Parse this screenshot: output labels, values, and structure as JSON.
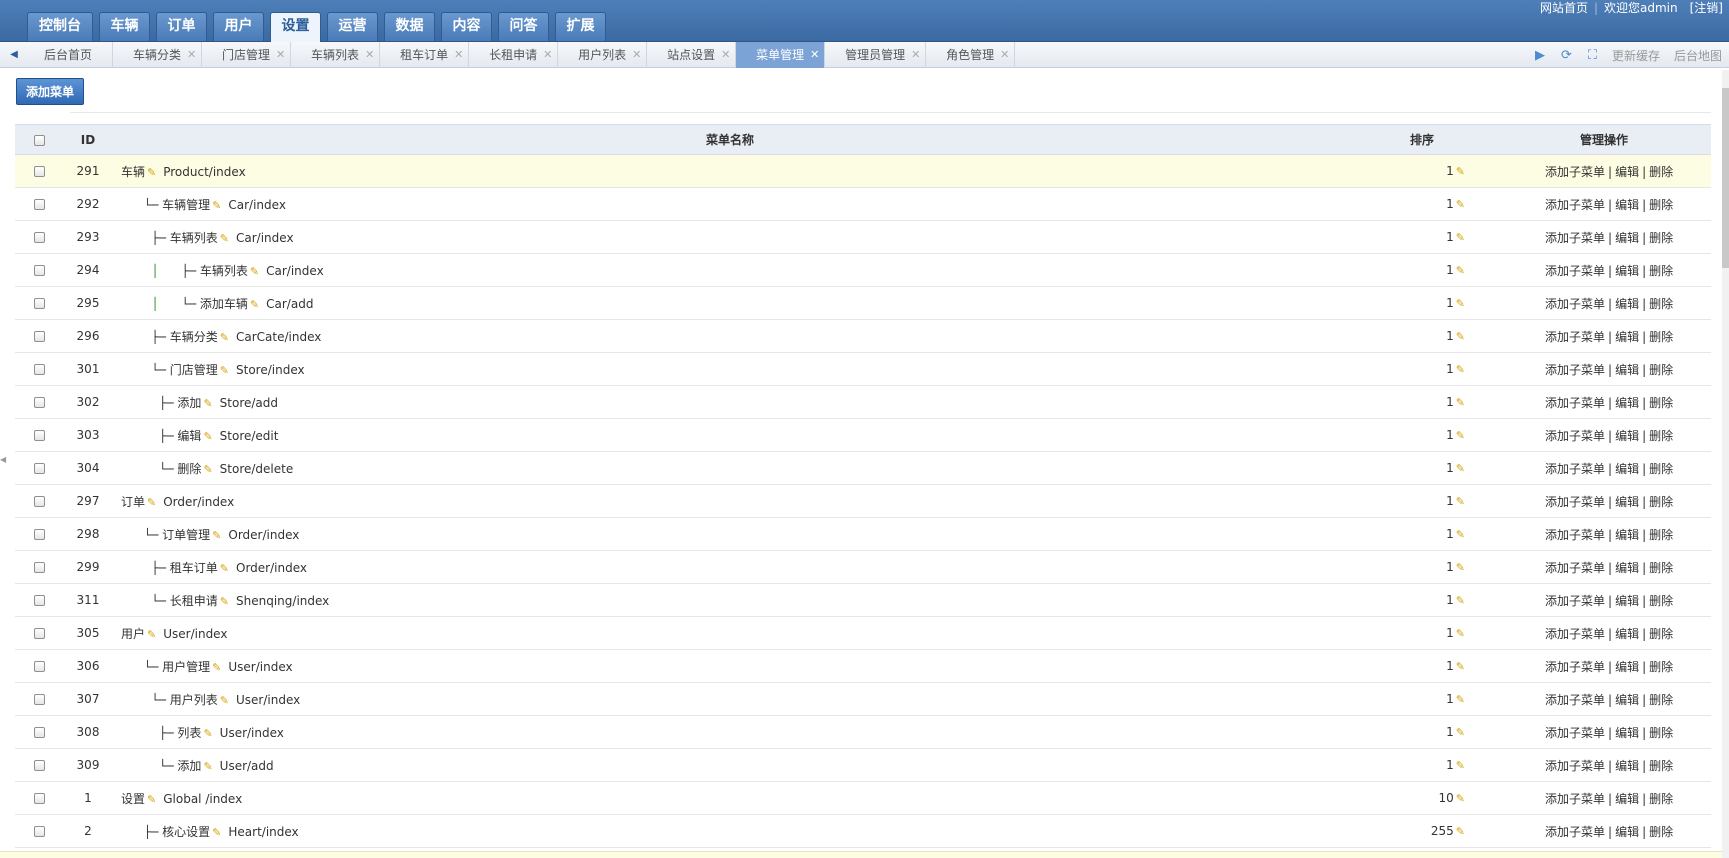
{
  "nav": {
    "tabs": [
      "控制台",
      "车辆",
      "订单",
      "用户",
      "设置",
      "运营",
      "数据",
      "内容",
      "问答",
      "扩展"
    ],
    "active_index": 4
  },
  "top_links": {
    "site_home": "网站首页",
    "welcome": "欢迎您admin",
    "logout": "[注销]"
  },
  "tabstrip": {
    "tabs": [
      {
        "label": "后台首页",
        "closable": false
      },
      {
        "label": "车辆分类",
        "closable": true
      },
      {
        "label": "门店管理",
        "closable": true
      },
      {
        "label": "车辆列表",
        "closable": true
      },
      {
        "label": "租车订单",
        "closable": true
      },
      {
        "label": "长租申请",
        "closable": true
      },
      {
        "label": "用户列表",
        "closable": true
      },
      {
        "label": "站点设置",
        "closable": true
      },
      {
        "label": "菜单管理",
        "closable": true,
        "active": true
      },
      {
        "label": "管理员管理",
        "closable": true
      },
      {
        "label": "角色管理",
        "closable": true
      }
    ],
    "close_glyph": "✕",
    "refresh_cache": "更新缓存",
    "site_map": "后台地图"
  },
  "toolbar": {
    "add_menu_label": "添加菜单"
  },
  "table": {
    "headers": {
      "id": "ID",
      "name": "菜单名称",
      "sort": "排序",
      "ops": "管理操作"
    },
    "op_labels": {
      "add_child": "添加子菜单",
      "edit": "编辑",
      "delete": "删除",
      "sep": "|"
    },
    "rows": [
      {
        "id": "291",
        "prefix": "",
        "green": "",
        "tail": "",
        "name": "车辆",
        "path": "Product/index",
        "sort": "1",
        "highlight": true
      },
      {
        "id": "292",
        "prefix": "      └─ ",
        "green": "",
        "tail": "",
        "name": "车辆管理",
        "path": "Car/index",
        "sort": "1"
      },
      {
        "id": "293",
        "prefix": "        ├─ ",
        "green": "",
        "tail": "",
        "name": "车辆列表",
        "path": "Car/index",
        "sort": "1"
      },
      {
        "id": "294",
        "prefix": "        ",
        "green": "│",
        "tail": "      ├─ ",
        "name": "车辆列表",
        "path": "Car/index",
        "sort": "1"
      },
      {
        "id": "295",
        "prefix": "        ",
        "green": "│",
        "tail": "      └─ ",
        "name": "添加车辆",
        "path": "Car/add",
        "sort": "1"
      },
      {
        "id": "296",
        "prefix": "        ├─ ",
        "green": "",
        "tail": "",
        "name": "车辆分类",
        "path": "CarCate/index",
        "sort": "1"
      },
      {
        "id": "301",
        "prefix": "        └─ ",
        "green": "",
        "tail": "",
        "name": "门店管理",
        "path": "Store/index",
        "sort": "1"
      },
      {
        "id": "302",
        "prefix": "          ├─ ",
        "green": "",
        "tail": "",
        "name": "添加",
        "path": "Store/add",
        "sort": "1"
      },
      {
        "id": "303",
        "prefix": "          ├─ ",
        "green": "",
        "tail": "",
        "name": "编辑",
        "path": "Store/edit",
        "sort": "1"
      },
      {
        "id": "304",
        "prefix": "          └─ ",
        "green": "",
        "tail": "",
        "name": "删除",
        "path": "Store/delete",
        "sort": "1"
      },
      {
        "id": "297",
        "prefix": "",
        "green": "",
        "tail": "",
        "name": "订单",
        "path": "Order/index",
        "sort": "1"
      },
      {
        "id": "298",
        "prefix": "      └─ ",
        "green": "",
        "tail": "",
        "name": "订单管理",
        "path": "Order/index",
        "sort": "1"
      },
      {
        "id": "299",
        "prefix": "        ├─ ",
        "green": "",
        "tail": "",
        "name": "租车订单",
        "path": "Order/index",
        "sort": "1"
      },
      {
        "id": "311",
        "prefix": "        └─ ",
        "green": "",
        "tail": "",
        "name": "长租申请",
        "path": "Shenqing/index",
        "sort": "1"
      },
      {
        "id": "305",
        "prefix": "",
        "green": "",
        "tail": "",
        "name": "用户",
        "path": "User/index",
        "sort": "1"
      },
      {
        "id": "306",
        "prefix": "      └─ ",
        "green": "",
        "tail": "",
        "name": "用户管理",
        "path": "User/index",
        "sort": "1"
      },
      {
        "id": "307",
        "prefix": "        └─ ",
        "green": "",
        "tail": "",
        "name": "用户列表",
        "path": "User/index",
        "sort": "1"
      },
      {
        "id": "308",
        "prefix": "          ├─ ",
        "green": "",
        "tail": "",
        "name": "列表",
        "path": "User/index",
        "sort": "1"
      },
      {
        "id": "309",
        "prefix": "          └─ ",
        "green": "",
        "tail": "",
        "name": "添加",
        "path": "User/add",
        "sort": "1"
      },
      {
        "id": "1",
        "prefix": "",
        "green": "",
        "tail": "",
        "name": "设置",
        "path": "Global /index",
        "sort": "10"
      },
      {
        "id": "2",
        "prefix": "      ├─ ",
        "green": "",
        "tail": "",
        "name": "核心设置",
        "path": "Heart/index",
        "sort": "255"
      }
    ]
  },
  "colors": {
    "topbar": "#3b6aa3",
    "active_tab": "#7ba3d6",
    "highlight_row": "#fdfde3",
    "pencil": "#d8a20c"
  }
}
